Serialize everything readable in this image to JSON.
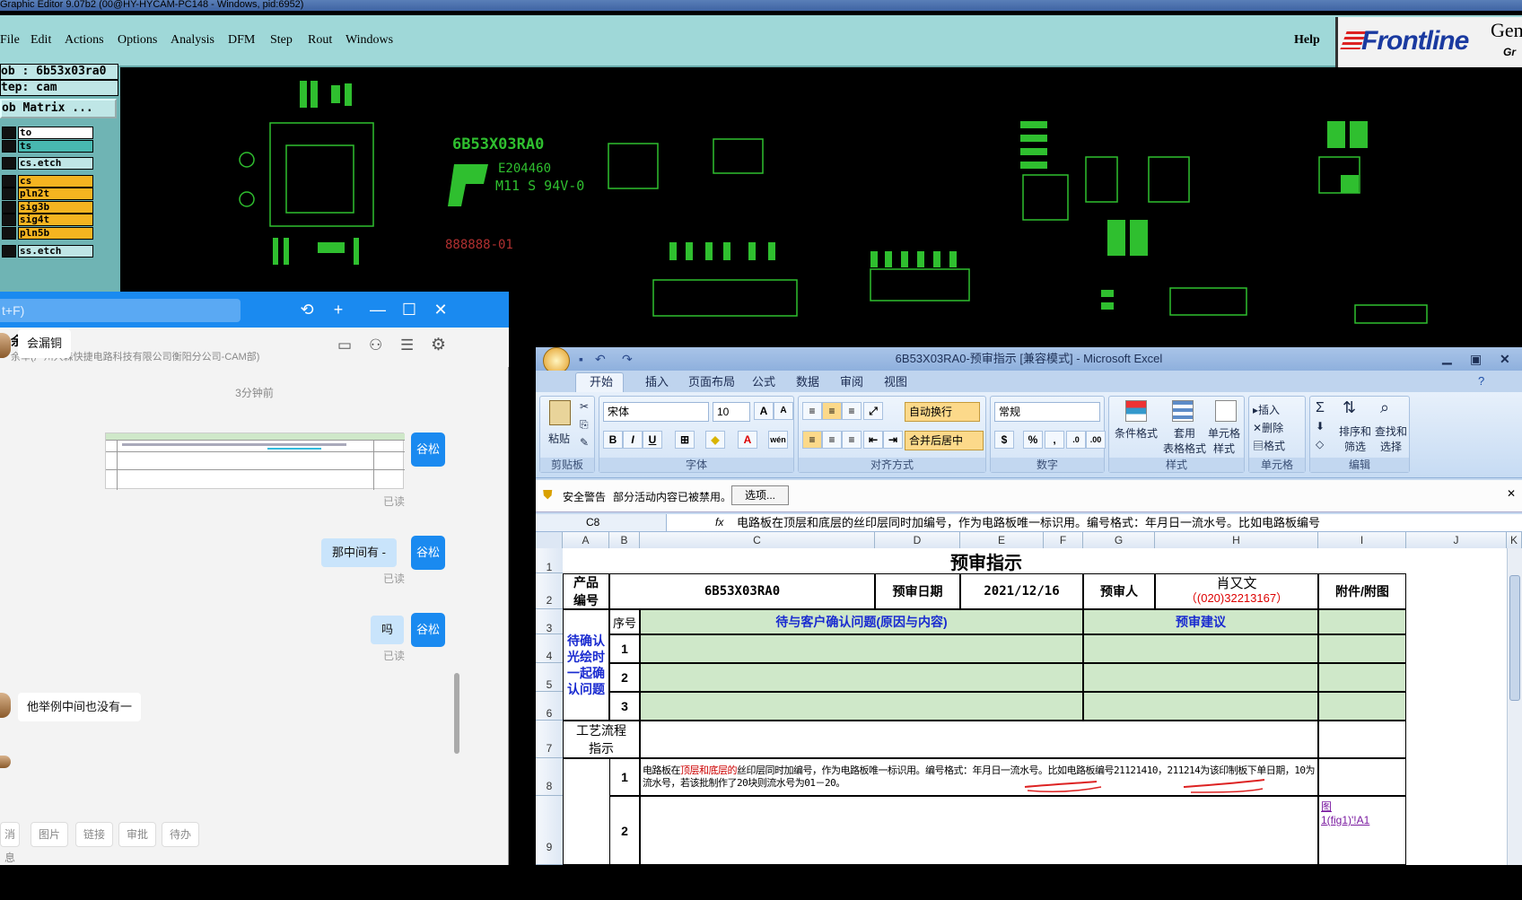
{
  "ge": {
    "title": "Graphic Editor 9.07b2 (00@HY-HYCAM-PC148 - Windows, pid:6952)",
    "menu": [
      "File",
      "Edit",
      "Actions",
      "Options",
      "Analysis",
      "DFM",
      "Step",
      "Rout",
      "Windows"
    ],
    "help": "Help",
    "logo": "Frontline",
    "logo_side": "Gen",
    "logo_side2": "Gr",
    "job": "ob : 6b53x03ra0",
    "step": "tep: cam",
    "matrix": "ob Matrix ...",
    "layers": [
      "to",
      "ts",
      "cs.etch",
      "cs",
      "pln2t",
      "sig3b",
      "sig4t",
      "pln5b",
      "ss.etch"
    ],
    "silk_part": "6B53X03RA0",
    "silk_cert": "E204460",
    "silk_grade": "M11 S 94V-0",
    "silk_date": "888888-01"
  },
  "chat": {
    "search_hint": "t+F)",
    "contact_name": "余 军",
    "contact_org": "余军(广州兴森快捷电路科技有限公司衡阳分公司-CAM部)",
    "msg1": "会漏铜",
    "time_sep": "3分钟前",
    "me_name": "谷松",
    "read": "已读",
    "msg2": "那中间有  -",
    "msg3": "吗",
    "msg4": "他举例中间也没有一",
    "toolbar": [
      "消息",
      "图片",
      "链接",
      "审批",
      "待办"
    ],
    "colors": {
      "accent": "#1a8af0"
    }
  },
  "excel": {
    "title": "6B53X03RA0-预审指示  [兼容模式]  -  Microsoft Excel",
    "tabs": [
      "开始",
      "插入",
      "页面布局",
      "公式",
      "数据",
      "审阅",
      "视图"
    ],
    "font_name": "宋体",
    "font_size": "10",
    "wrap": "自动换行",
    "merge": "合并后居中",
    "numfmt": "常规",
    "groups": [
      "剪贴板",
      "字体",
      "对齐方式",
      "数字",
      "样式",
      "单元格",
      "编辑"
    ],
    "paste": "粘贴",
    "cond_fmt": "条件格式",
    "table_fmt": "套用\n表格格式",
    "cell_style": "单元格\n样式",
    "insert": "插入",
    "delete": "删除",
    "format": "格式",
    "sort": "排序和\n筛选",
    "find": "查找和\n选择",
    "warn_title": "安全警告",
    "warn_text": "部分活动内容已被禁用。",
    "warn_btn": "选项...",
    "cellref": "C8",
    "formula": "电路板在顶层和底层的丝印层同时加编号，作为电路板唯一标识用。编号格式：年月日一流水号。比如电路板编号",
    "cols": [
      "A",
      "B",
      "C",
      "D",
      "E",
      "F",
      "G",
      "H",
      "I",
      "J",
      "K"
    ],
    "rows": [
      "1",
      "2",
      "3",
      "4",
      "5",
      "6",
      "7",
      "8",
      "9"
    ],
    "sheet_title": "预审指示",
    "prod_label": "产品\n编号",
    "prod_code": "6B53X03RA0",
    "date_label": "预审日期",
    "date_val": "2021/12/16",
    "reviewer_label": "预审人",
    "reviewer": "肖又文",
    "phone": "（(020)32213167）",
    "attach": "附件/附图",
    "confirm_label": "待确认\n光绘时\n一起确\n认问题",
    "seq": "序号",
    "issue_head": "待与客户确认问题(原因与内容)",
    "advice_head": "预审建议",
    "n1": "1",
    "n2": "2",
    "n3": "3",
    "process": "工艺流程\n指示",
    "note_a": "电路板在",
    "note_b": "顶层和底层的",
    "note_c": "丝印层同时加编号，作为电路板唯一标识用。编号格式：年月日一流水号。比如电路板编号21121410，211214为该印制板下单日期，10为流水号，若该批制作了20块则流水号为01－20。",
    "fig_link": "图\n1(fig1)'!A1"
  }
}
